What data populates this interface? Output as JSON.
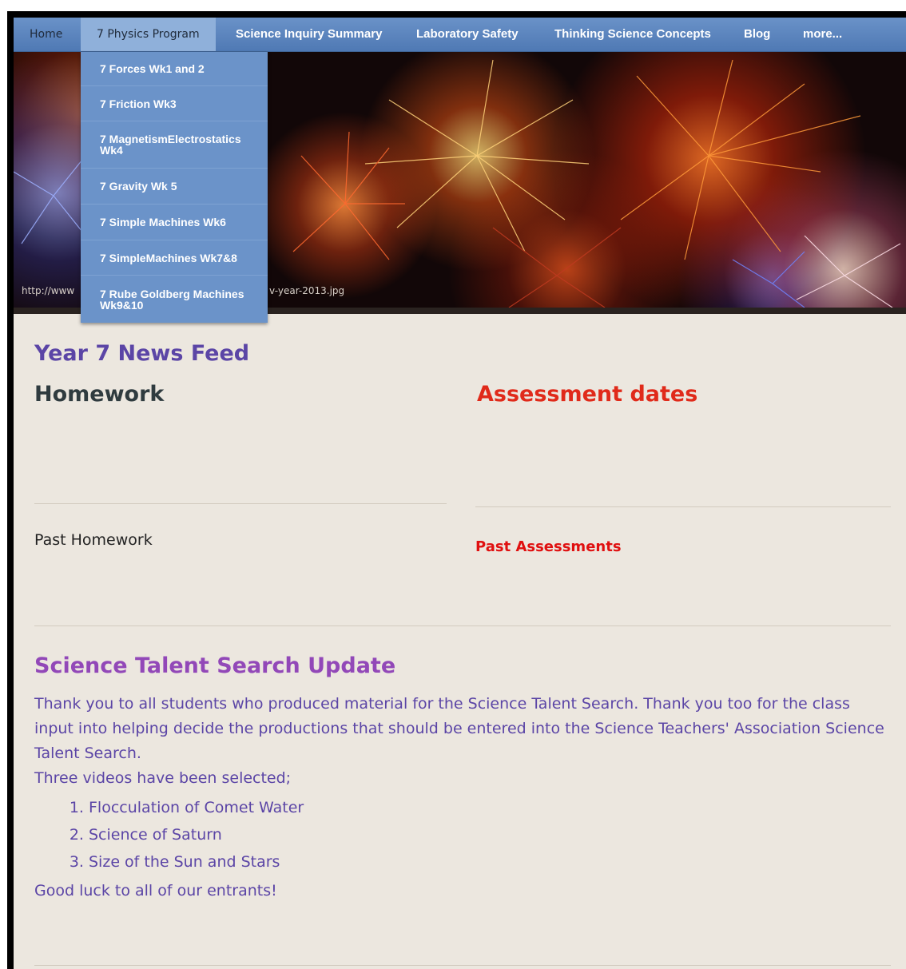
{
  "nav": {
    "items": [
      {
        "label": "Home"
      },
      {
        "label": "7 Physics Program"
      },
      {
        "label": "Science Inquiry Summary"
      },
      {
        "label": "Laboratory Safety"
      },
      {
        "label": "Thinking Science Concepts"
      },
      {
        "label": "Blog"
      },
      {
        "label": "more..."
      }
    ]
  },
  "dropdown": {
    "items": [
      {
        "label": "7 Forces Wk1 and 2"
      },
      {
        "label": "7 Friction Wk3"
      },
      {
        "label": "7 MagnetismElectrostatics Wk4"
      },
      {
        "label": "7 Gravity Wk 5"
      },
      {
        "label": "7 Simple Machines Wk6"
      },
      {
        "label": "7 SimpleMachines Wk7&8"
      },
      {
        "label": "7 Rube Goldberg Machines Wk9&10"
      }
    ]
  },
  "banner": {
    "caption_left": "http://www",
    "caption_right": "v-year-2013.jpg"
  },
  "main": {
    "news_feed_title": "Year 7 News Feed",
    "homework_title": "Homework",
    "assessment_title": "Assessment dates",
    "past_homework": "Past Homework",
    "past_assessments": "Past Assessments",
    "talent": {
      "title": "Science Talent Search Update",
      "paragraph": "Thank you to all students who produced material for the Science Talent Search. Thank you too for the class input into helping decide the productions that should be entered into the Science Teachers' Association Science Talent Search.",
      "intro": "Three videos have been selected;",
      "videos": [
        "Flocculation of Comet Water",
        "Science of Saturn",
        "Size of the Sun and Stars"
      ],
      "closing": "Good luck to all of our entrants!"
    }
  },
  "colors": {
    "nav_bg": "#5a83bd",
    "nav_active": "#8fb0da",
    "page_bg": "#ece7df",
    "heading_purple": "#5b45a6",
    "talent_purple": "#9248b8",
    "assessment_red": "#e02a1a"
  }
}
